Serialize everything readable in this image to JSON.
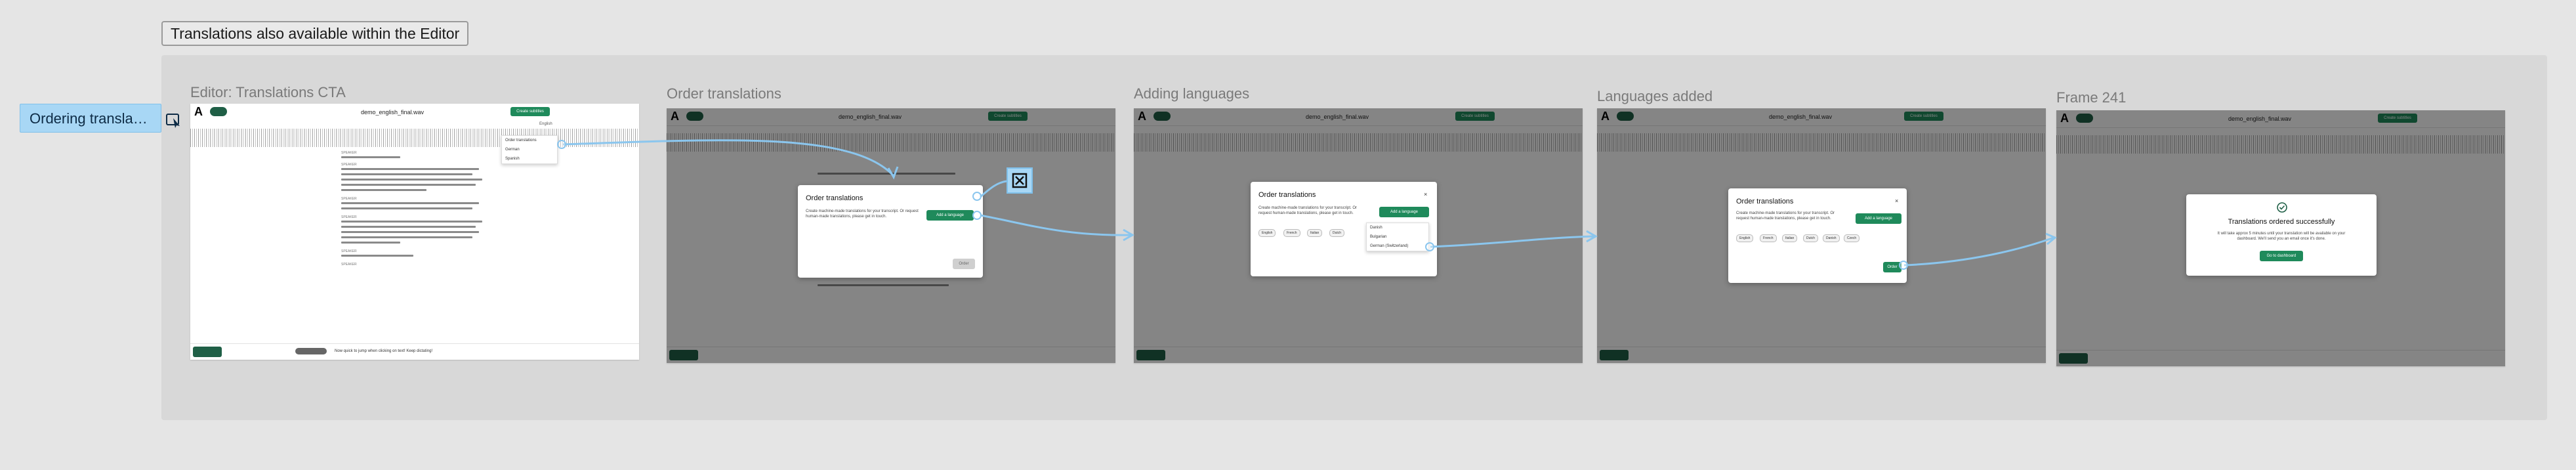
{
  "section": {
    "label": "Translations also available within the Editor"
  },
  "callout": {
    "label": "Ordering transla…"
  },
  "frames": [
    {
      "title": "Editor: Translations CTA"
    },
    {
      "title": "Order translations"
    },
    {
      "title": "Adding languages"
    },
    {
      "title": "Languages added"
    },
    {
      "title": "Frame 241"
    }
  ],
  "editor": {
    "file_name": "demo_english_final.wav",
    "export_label": "Create subtitles",
    "language": "English",
    "speaker": "SPEAKER",
    "status_text": "Now quick to jump when clicking on text! Keep dictating!"
  },
  "dropdown_translate": {
    "items": [
      "Order translations",
      "German",
      "Spanish"
    ]
  },
  "modal_order": {
    "title": "Order translations",
    "description": "Create machine-made translations for your transcript. Or request human-made translations, please get in touch.",
    "add_button": "Add a language",
    "order_button": "Order",
    "close_label": "×"
  },
  "modal_adding": {
    "title": "Order translations",
    "tags": [
      "English",
      "French",
      "Italian",
      "Dutch"
    ],
    "options": [
      "Danish",
      "Bulgarian",
      "German (Switzerland)"
    ]
  },
  "modal_added": {
    "title": "Order translations",
    "tags": [
      "English",
      "French",
      "Italian",
      "Dutch",
      "Danish",
      "Czech"
    ],
    "order_button": "Order"
  },
  "modal_success": {
    "title": "Translations ordered successfully",
    "description": "It will take approx 5 minutes until your translation will be available on your dashboard. We'll send you an email once it's done.",
    "button": "Go to dashboard"
  },
  "colors": {
    "prototype_arrow": "#8bc6ee",
    "brand_green": "#1f5f46",
    "button_green": "#1f8a5b",
    "callout_bg": "#a8d7f5"
  }
}
